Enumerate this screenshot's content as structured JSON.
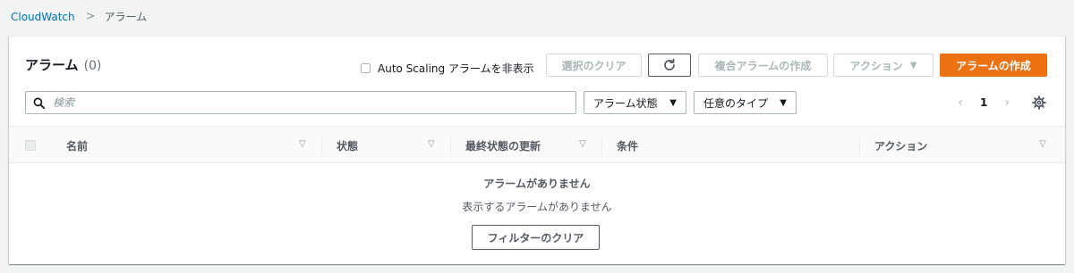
{
  "breadcrumb": {
    "root": "CloudWatch",
    "separator": ">",
    "current": "アラーム"
  },
  "header": {
    "title": "アラーム",
    "count": "(0)",
    "autoscaling_label": "Auto Scaling アラームを非表示",
    "autoscaling_checked": false
  },
  "toolbar": {
    "clear_selection": "選択のクリア",
    "composite_create": "複合アラームの作成",
    "actions": "アクション",
    "actions_caret": "▼",
    "create": "アラームの作成"
  },
  "filters": {
    "search_placeholder": "検索",
    "alarm_state": "アラーム状態",
    "any_type": "任意のタイプ"
  },
  "pagination": {
    "page": "1",
    "prev": "‹",
    "next": "›"
  },
  "table": {
    "columns": [
      "名前",
      "状態",
      "最終状態の更新",
      "条件",
      "アクション"
    ]
  },
  "empty": {
    "title": "アラームがありません",
    "subtitle": "表示するアラームがありません",
    "clear_filters": "フィルターのクリア"
  },
  "colors": {
    "primary": "#ec7211",
    "link": "#0073bb"
  },
  "icons": {
    "refresh": "refresh-icon",
    "search": "search-icon",
    "settings": "gear-icon"
  }
}
